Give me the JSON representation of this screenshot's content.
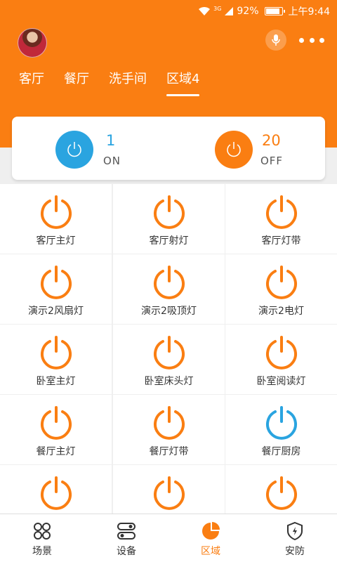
{
  "status_bar": {
    "network": "3G",
    "battery": "92%",
    "battery_fraction": 0.92,
    "time": "上午9:44"
  },
  "tabs": [
    {
      "label": "客厅",
      "active": false
    },
    {
      "label": "餐厅",
      "active": false
    },
    {
      "label": "洗手间",
      "active": false
    },
    {
      "label": "区域4",
      "active": true
    }
  ],
  "summary": {
    "on_count": "1",
    "on_label": "ON",
    "off_count": "20",
    "off_label": "OFF"
  },
  "devices": [
    {
      "name": "客厅主灯",
      "on": false
    },
    {
      "name": "客厅射灯",
      "on": false
    },
    {
      "name": "客厅灯带",
      "on": false
    },
    {
      "name": "演示2风扇灯",
      "on": false
    },
    {
      "name": "演示2吸顶灯",
      "on": false
    },
    {
      "name": "演示2电灯",
      "on": false
    },
    {
      "name": "卧室主灯",
      "on": false
    },
    {
      "name": "卧室床头灯",
      "on": false
    },
    {
      "name": "卧室阅读灯",
      "on": false
    },
    {
      "name": "餐厅主灯",
      "on": false
    },
    {
      "name": "餐厅灯带",
      "on": false
    },
    {
      "name": "餐厅厨房",
      "on": true
    },
    {
      "name": "",
      "on": false
    },
    {
      "name": "",
      "on": false
    },
    {
      "name": "",
      "on": false
    }
  ],
  "bottom_nav": [
    {
      "label": "场景",
      "icon": "scene-icon",
      "active": false
    },
    {
      "label": "设备",
      "icon": "device-icon",
      "active": false
    },
    {
      "label": "区域",
      "icon": "area-icon",
      "active": true
    },
    {
      "label": "安防",
      "icon": "security-icon",
      "active": false
    }
  ],
  "colors": {
    "accent": "#fa7e12",
    "on": "#2aa4e0",
    "off": "#fa7e12"
  }
}
